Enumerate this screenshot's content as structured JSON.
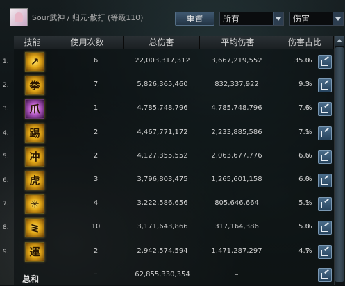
{
  "header": {
    "title": "Sour武神 / 归元·散打 (等级110)",
    "reset_label": "重置",
    "filter_select": "所有",
    "metric_select": "伤害"
  },
  "table": {
    "columns": [
      "技能",
      "使用次数",
      "总伤害",
      "平均伤害",
      "伤害占比"
    ],
    "rows": [
      {
        "num": "1.",
        "icon": "slash-skill-icon",
        "glyph": "↗",
        "count": "6",
        "total": "22,003,317,312",
        "avg": "3,667,219,552",
        "pct": "35.0",
        "pct_unit": "%"
      },
      {
        "num": "2.",
        "icon": "fist-skill-icon",
        "glyph": "拳",
        "count": "7",
        "total": "5,826,365,460",
        "avg": "832,337,922",
        "pct": "9.3",
        "pct_unit": "%"
      },
      {
        "num": "3.",
        "icon": "purple-strike-skill-icon",
        "glyph": "爪",
        "count": "1",
        "total": "4,785,748,796",
        "avg": "4,785,748,796",
        "pct": "7.6",
        "pct_unit": "%"
      },
      {
        "num": "4.",
        "icon": "kick-skill-icon",
        "glyph": "踢",
        "count": "2",
        "total": "4,467,771,172",
        "avg": "2,233,885,586",
        "pct": "7.1",
        "pct_unit": "%"
      },
      {
        "num": "5.",
        "icon": "dash-skill-icon",
        "glyph": "冲",
        "count": "2",
        "total": "4,127,355,552",
        "avg": "2,063,677,776",
        "pct": "6.6",
        "pct_unit": "%"
      },
      {
        "num": "6.",
        "icon": "tiger-skill-icon",
        "glyph": "虎",
        "count": "3",
        "total": "3,796,803,475",
        "avg": "1,265,601,158",
        "pct": "6.0",
        "pct_unit": "%"
      },
      {
        "num": "7.",
        "icon": "burst-skill-icon",
        "glyph": "✳",
        "count": "4",
        "total": "3,222,586,656",
        "avg": "805,646,664",
        "pct": "5.1",
        "pct_unit": "%"
      },
      {
        "num": "8.",
        "icon": "wave-skill-icon",
        "glyph": "≷",
        "count": "10",
        "total": "3,171,643,866",
        "avg": "317,164,386",
        "pct": "5.0",
        "pct_unit": "%"
      },
      {
        "num": "9.",
        "icon": "fortune-skill-icon",
        "glyph": "運",
        "count": "2",
        "total": "2,942,574,594",
        "avg": "1,471,287,297",
        "pct": "4.7",
        "pct_unit": "%"
      }
    ],
    "total": {
      "label": "总和",
      "count": "–",
      "total": "62,855,330,354",
      "avg": "–"
    }
  },
  "colors": {
    "accent": "#3f5870",
    "icon_gold": "#e0a516",
    "icon_purple": "#b156c2"
  }
}
